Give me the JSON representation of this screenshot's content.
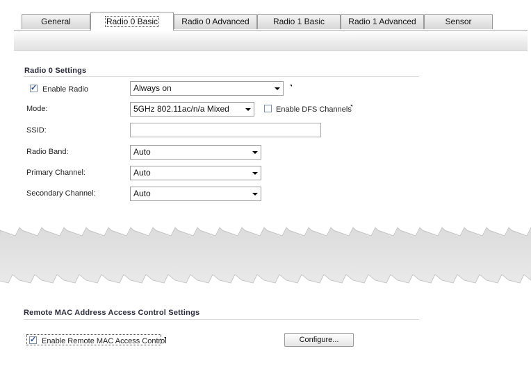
{
  "tabs": [
    {
      "label": "General"
    },
    {
      "label": "Radio 0 Basic"
    },
    {
      "label": "Radio 0 Advanced"
    },
    {
      "label": "Radio 1 Basic"
    },
    {
      "label": "Radio 1 Advanced"
    },
    {
      "label": "Sensor"
    }
  ],
  "active_tab": "Radio 0 Basic",
  "radio0": {
    "title": "Radio 0 Settings",
    "enable_radio": {
      "label": "Enable Radio",
      "checked": true
    },
    "schedule": {
      "value": "Always on"
    },
    "mode": {
      "label": "Mode:",
      "value": "5GHz 802.11ac/n/a Mixed"
    },
    "dfs": {
      "label": "Enable DFS Channels",
      "checked": false
    },
    "ssid": {
      "label": "SSID:",
      "value": ""
    },
    "radio_band": {
      "label": "Radio Band:",
      "value": "Auto"
    },
    "primary_channel": {
      "label": "Primary Channel:",
      "value": "Auto"
    },
    "secondary_channel": {
      "label": "Secondary Channel:",
      "value": "Auto"
    }
  },
  "mac_acl": {
    "title": "Remote MAC Address Access Control Settings",
    "enable": {
      "label": "Enable Remote MAC Access Control",
      "checked": true
    },
    "configure_label": "Configure..."
  },
  "colors": {
    "torn_band": "#e8e8e8",
    "section_title": "#2b2b3c"
  }
}
